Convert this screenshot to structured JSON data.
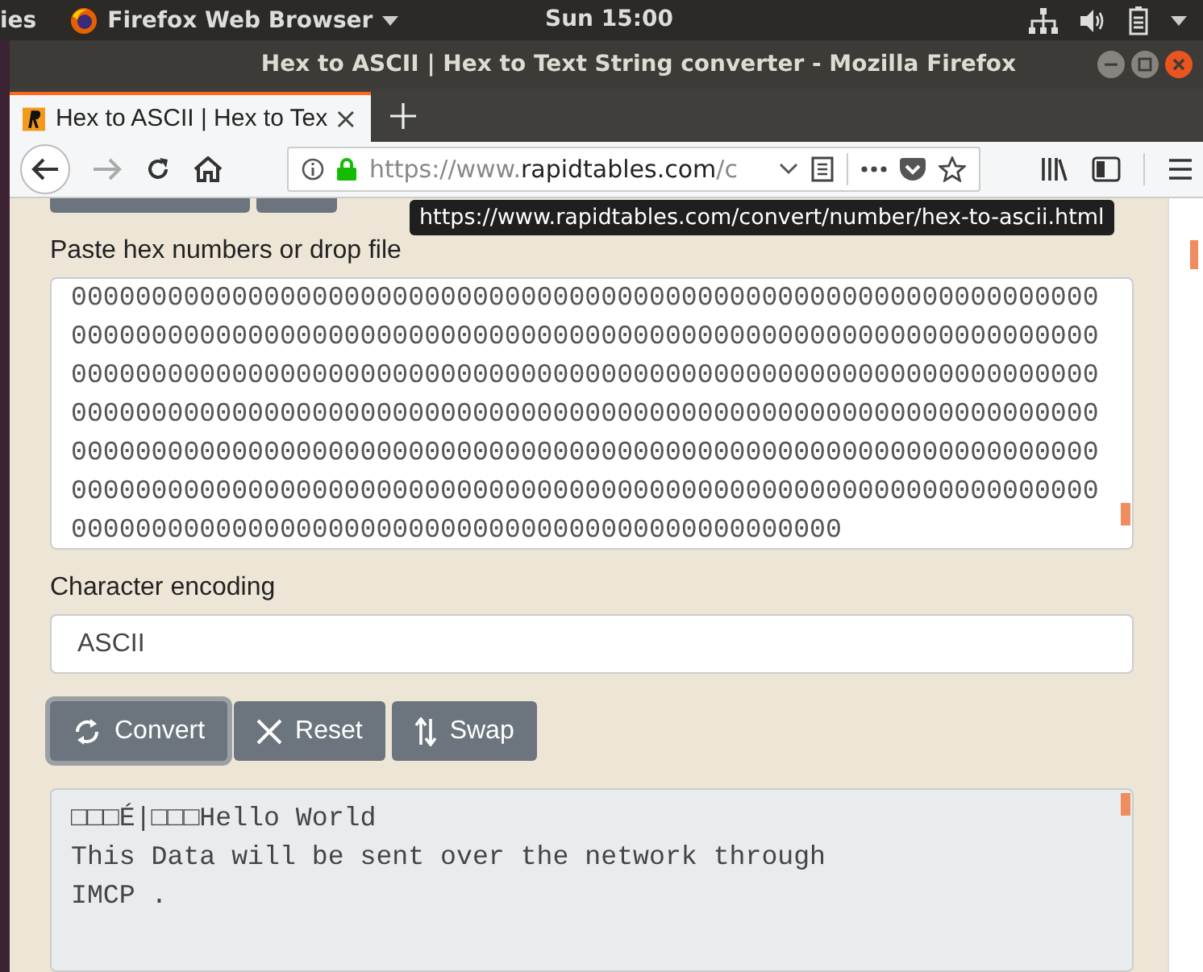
{
  "top_bar": {
    "activities": "ies",
    "app_menu": "Firefox Web Browser",
    "clock": "Sun 15:00"
  },
  "window": {
    "title": "Hex to ASCII | Hex to Text String converter - Mozilla Firefox"
  },
  "tabs": [
    {
      "label": "Hex to ASCII | Hex to Tex",
      "selected": true
    }
  ],
  "address_bar": {
    "url_prefix": "https://www.",
    "url_domain": "rapidtables.com",
    "url_rest": "/c"
  },
  "tooltip": "https://www.rapidtables.com/convert/number/hex-to-ascii.html",
  "input": {
    "label": "Paste hex numbers or drop file",
    "lines": [
      "0000000000000000000000000000000000000000000000000000000000000000",
      "0000000000000000000000000000000000000000000000000000000000000000",
      "0000000000000000000000000000000000000000000000000000000000000000",
      "0000000000000000000000000000000000000000000000000000000000000000",
      "0000000000000000000000000000000000000000000000000000000000000000",
      "0000000000000000000000000000000000000000000000000000000000000000",
      "000000000000000000000000000000000000000000000000"
    ]
  },
  "encoding": {
    "label": "Character encoding",
    "value": "ASCII"
  },
  "buttons": [
    {
      "kind": "convert",
      "label": "Convert",
      "focused": true
    },
    {
      "kind": "reset",
      "label": "Reset",
      "focused": false
    },
    {
      "kind": "swap",
      "label": "Swap",
      "focused": false
    }
  ],
  "output": {
    "lines": [
      "□□□É|□□□Hello World",
      "This Data will be sent over the network through",
      "IMCP ."
    ]
  }
}
